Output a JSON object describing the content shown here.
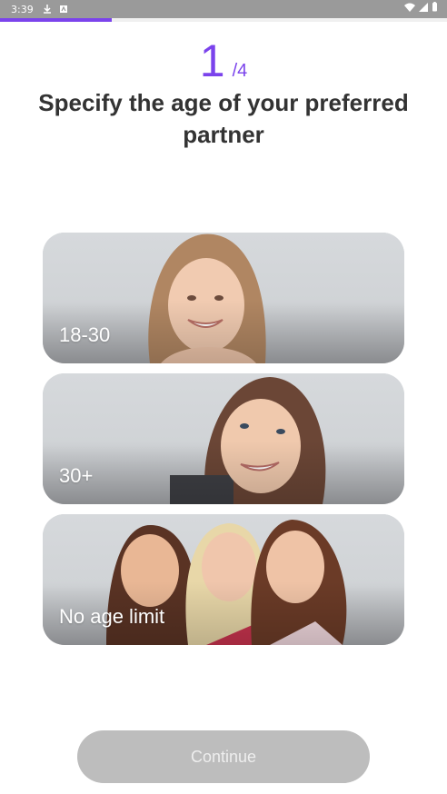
{
  "status_bar": {
    "time": "3:39"
  },
  "progress": {
    "fraction": 0.25,
    "color": "#7b43ec"
  },
  "step": {
    "current": "1",
    "total": "/4"
  },
  "title": "Specify the age of your preferred partner",
  "options": [
    {
      "label": "18-30"
    },
    {
      "label": "30+"
    },
    {
      "label": "No age limit"
    }
  ],
  "continue_label": "Continue",
  "colors": {
    "accent": "#7b43ec",
    "button_disabled": "#bdbdbd"
  }
}
